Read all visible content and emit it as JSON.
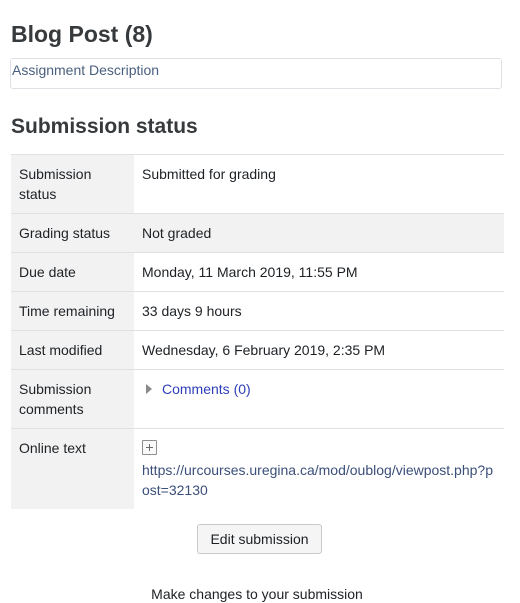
{
  "page": {
    "title": "Blog Post (8)",
    "assignment_description": "Assignment Description",
    "section_title": "Submission status"
  },
  "status_table": {
    "rows": [
      {
        "label": "Submission status",
        "value": "Submitted for grading"
      },
      {
        "label": "Grading status",
        "value": "Not graded"
      },
      {
        "label": "Due date",
        "value": "Monday, 11 March 2019, 11:55 PM"
      },
      {
        "label": "Time remaining",
        "value": "33 days 9 hours"
      },
      {
        "label": "Last modified",
        "value": "Wednesday, 6 February 2019, 2:35 PM"
      },
      {
        "label": "Submission comments",
        "value": "Comments (0)"
      },
      {
        "label": "Online text",
        "value": "https://urcourses.uregina.ca/mod/oublog/viewpost.php?post=32130"
      }
    ]
  },
  "actions": {
    "edit_label": "Edit submission",
    "help_text": "Make changes to your submission"
  },
  "colors": {
    "link": "#2f3fb8",
    "label_bg": "#f2f2f2",
    "border": "#dee2e6"
  },
  "icons": {
    "expand": "expand-plus-icon",
    "toggle": "triangle-right-icon"
  }
}
